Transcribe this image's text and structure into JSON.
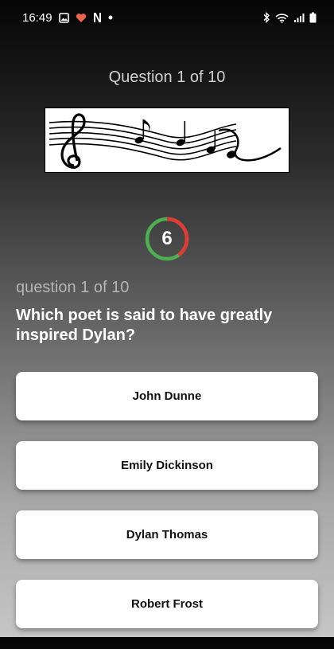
{
  "status_bar": {
    "time": "16:49",
    "left_icons": [
      "gallery-icon",
      "heart-app-icon",
      "netflix-icon",
      "dot-icon"
    ],
    "right_icons": [
      "bluetooth-icon",
      "wifi-icon",
      "signal-icon",
      "battery-icon"
    ]
  },
  "header": {
    "title": "Question 1 of 10"
  },
  "timer": {
    "value": "6",
    "elapsed_fraction": 0.4,
    "colors": {
      "remaining": "#4caf50",
      "elapsed": "#e53935"
    }
  },
  "question": {
    "counter": "question 1 of 10",
    "text": "Which poet is said to have greatly inspired Dylan?"
  },
  "answers": [
    {
      "label": "John Dunne"
    },
    {
      "label": "Emily Dickinson"
    },
    {
      "label": "Dylan Thomas"
    },
    {
      "label": "Robert Frost"
    }
  ]
}
